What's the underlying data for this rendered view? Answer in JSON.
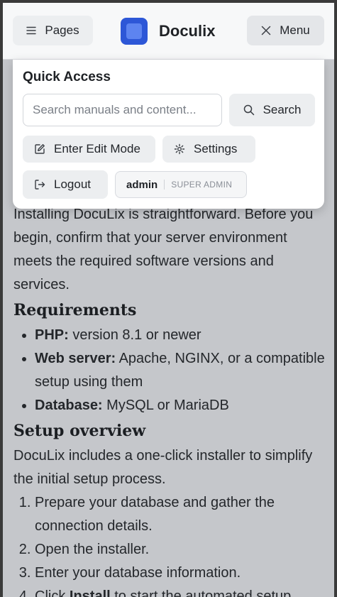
{
  "header": {
    "pages_label": "Pages",
    "brand_name": "Doculix",
    "menu_label": "Menu"
  },
  "quick_access": {
    "title": "Quick Access",
    "search_placeholder": "Search manuals and content...",
    "search_label": "Search",
    "edit_label": "Enter Edit Mode",
    "settings_label": "Settings",
    "logout_label": "Logout",
    "user": {
      "name": "admin",
      "role": "SUPER ADMIN"
    }
  },
  "content": {
    "intro": "Installing DocuLix is straightforward. Before you begin, confirm that your server environment meets the required software versions and services.",
    "requirements_heading": "Requirements",
    "requirements": [
      {
        "term": "PHP:",
        "desc": " version 8.1 or newer"
      },
      {
        "term": "Web server:",
        "desc": " Apache, NGINX, or a compatible setup using them"
      },
      {
        "term": "Database:",
        "desc": " MySQL or MariaDB"
      }
    ],
    "setup_heading": "Setup overview",
    "setup_intro": "DocuLix includes a one-click installer to simplify the initial setup process.",
    "steps": [
      "Prepare your database and gather the connection details.",
      "Open the installer.",
      "Enter your database information."
    ],
    "step4_prefix": "Click ",
    "step4_bold": "Install",
    "step4_suffix": " to start the automated setup."
  },
  "colors": {
    "brand": "#2d57d7",
    "overlay": "#c5c7cb"
  }
}
